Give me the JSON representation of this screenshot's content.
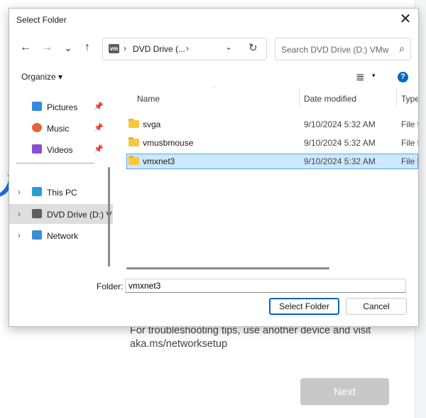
{
  "background": {
    "help_text": "For troubleshooting tips, use another device and visit aka.ms/networksetup",
    "next_label": "Next"
  },
  "dialog": {
    "title": "Select Folder",
    "close_glyph": "✕",
    "nav": {
      "back": "←",
      "forward": "→",
      "recent": "⌄",
      "up": "↑"
    },
    "address": {
      "drive_badge": "vm",
      "crumb": "DVD Drive (...",
      "sep1": "›",
      "sep2": "›",
      "dropdown": "⌄",
      "refresh": "↻"
    },
    "search": {
      "placeholder": "Search DVD Drive (D:) VMw...",
      "icon": "⌕"
    },
    "command_bar": {
      "organize": "Organize ▾",
      "view_glyph": "≣",
      "view_drop": "▾",
      "help": "?"
    },
    "nav_pane": {
      "items": [
        {
          "label": "Pictures",
          "icon": "pictures-icon",
          "color": "#2f8fd8",
          "pinned": true
        },
        {
          "label": "Music",
          "icon": "music-icon",
          "color": "#e2643f",
          "pinned": true
        },
        {
          "label": "Videos",
          "icon": "videos-icon",
          "color": "#8a4fd0",
          "pinned": true
        },
        {
          "label": "This PC",
          "icon": "this-pc-icon",
          "color": "#2d9ad6",
          "chevron": "›"
        },
        {
          "label": "DVD Drive (D:) V",
          "icon": "dvd-drive-icon",
          "color": "#5e5e5e",
          "chevron": "›",
          "selected": true
        },
        {
          "label": "Network",
          "icon": "network-icon",
          "color": "#3a8fd0",
          "chevron": "›"
        }
      ],
      "pin_glyph": "📌"
    },
    "file_list": {
      "columns": {
        "name": "Name",
        "date": "Date modified",
        "type": "Type"
      },
      "sort_glyph": "^",
      "rows": [
        {
          "name": "svga",
          "date": "9/10/2024 5:32 AM",
          "type": "File fo"
        },
        {
          "name": "vmusbmouse",
          "date": "9/10/2024 5:32 AM",
          "type": "File fo"
        },
        {
          "name": "vmxnet3",
          "date": "9/10/2024 5:32 AM",
          "type": "File fo",
          "selected": true
        }
      ]
    },
    "footer": {
      "folder_label": "Folder:",
      "folder_value": "vmxnet3",
      "select_label": "Select Folder",
      "cancel_label": "Cancel"
    }
  }
}
